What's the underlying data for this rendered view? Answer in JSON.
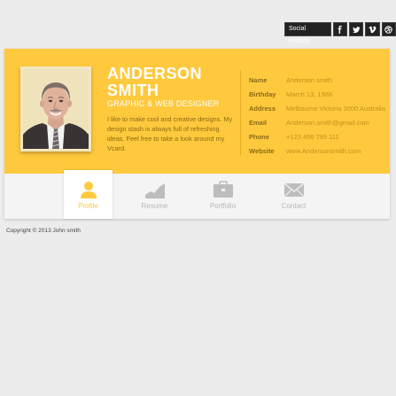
{
  "social": {
    "label": "Social Profiles",
    "buttons": [
      "facebook-icon",
      "twitter-icon",
      "vimeo-icon",
      "dribbble-icon"
    ],
    "glyphs": [
      "f",
      "",
      "V",
      ""
    ]
  },
  "profile": {
    "first_name": "ANDERSON",
    "last_name": "SMITH",
    "role": "GRAPHIC & WEB DESIGNER",
    "bio": "I like to make cool and creative designs. My design stash is always full of refreshing ideas. Feel free to take a look around my Vcard."
  },
  "info": [
    {
      "key": "Name",
      "value": "Anderson smith"
    },
    {
      "key": "Birthday",
      "value": "March 13, 1988"
    },
    {
      "key": "Address",
      "value": "Melbourne Victoria 3000 Australia"
    },
    {
      "key": "Email",
      "value": "Anderson.smith@gmail.com"
    },
    {
      "key": "Phone",
      "value": "+123 456 789 111"
    },
    {
      "key": "Website",
      "value": "www.Andersonsmith.com"
    }
  ],
  "nav": [
    {
      "label": "Profile",
      "icon": "user-icon",
      "active": true
    },
    {
      "label": "Resume",
      "icon": "chart-icon",
      "active": false
    },
    {
      "label": "Portfolio",
      "icon": "briefcase-icon",
      "active": false
    },
    {
      "label": "Contact",
      "icon": "envelope-icon",
      "active": false
    }
  ],
  "footer": {
    "copyright": "Copyright © 2013 John smith"
  },
  "colors": {
    "accent": "#ffc93d",
    "accent_dark": "#8c6a12",
    "background": "#ececec"
  }
}
